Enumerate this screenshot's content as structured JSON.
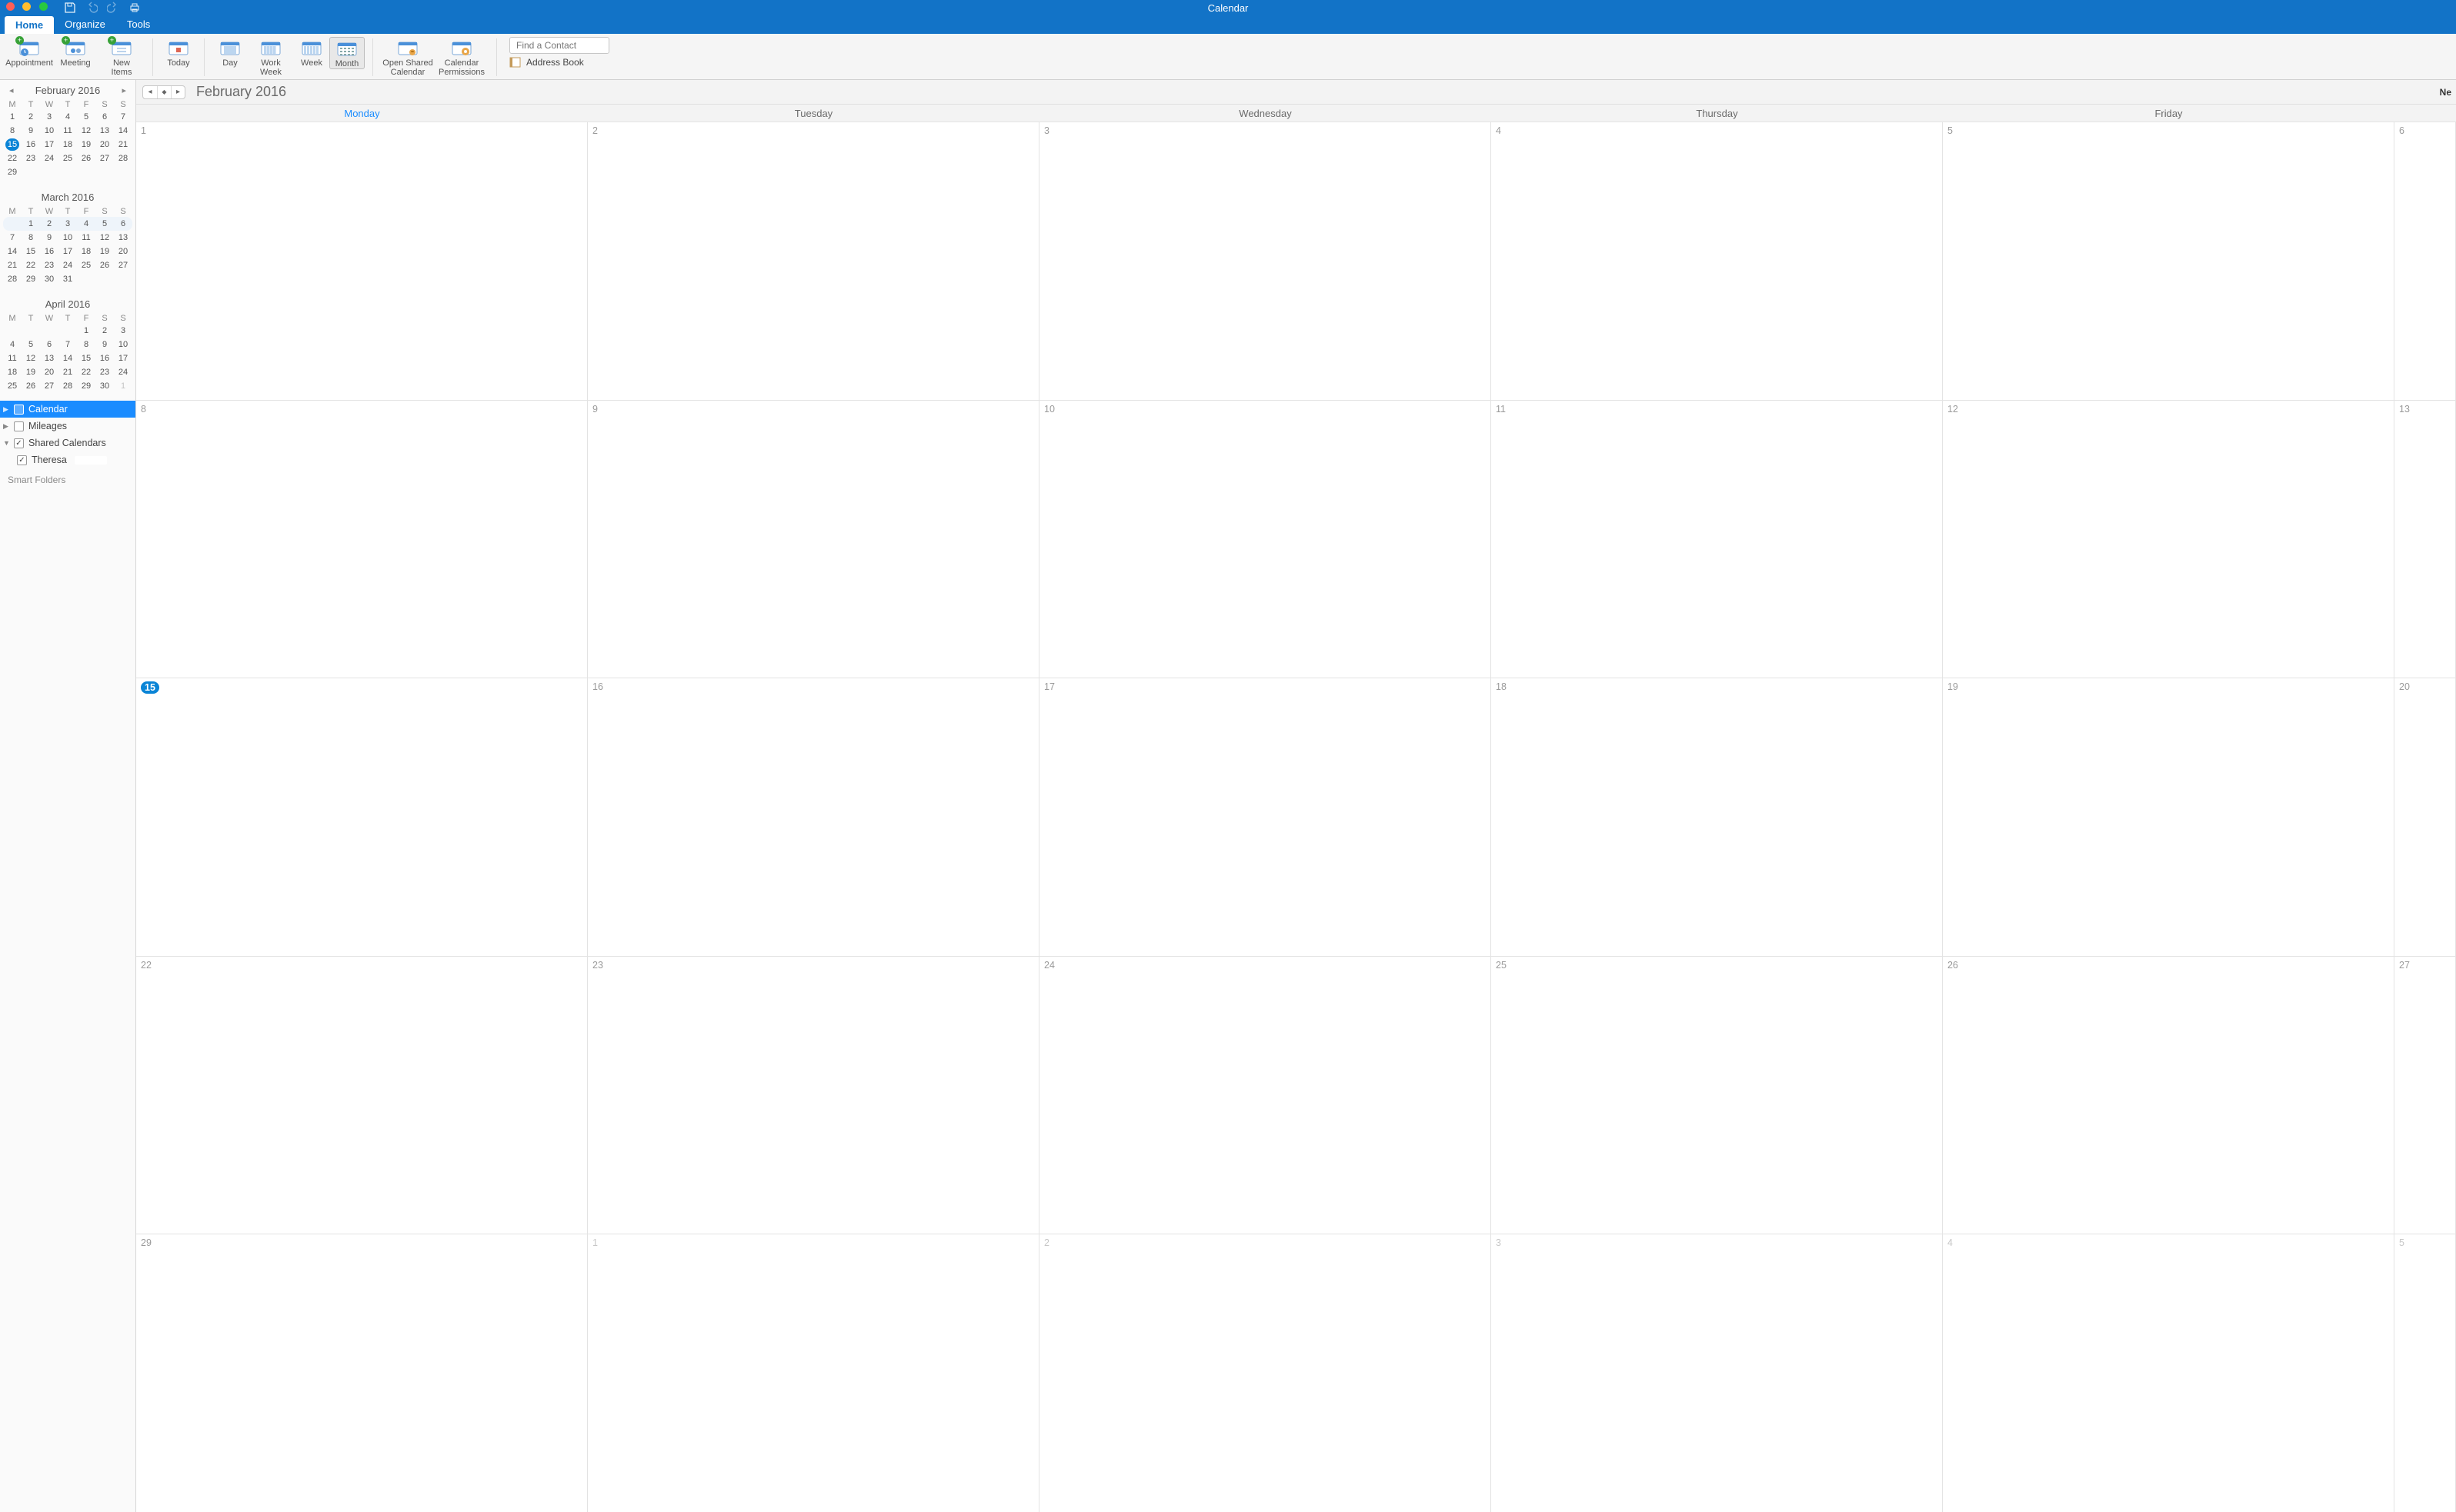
{
  "window": {
    "title": "Calendar",
    "truncated_right": "Ne"
  },
  "menutabs": [
    "Home",
    "Organize",
    "Tools"
  ],
  "active_tab": 0,
  "ribbon": {
    "groups": [
      [
        {
          "id": "appointment",
          "label": "Appointment",
          "plus": true
        },
        {
          "id": "meeting",
          "label": "Meeting",
          "plus": true
        },
        {
          "id": "new-items",
          "label": "New\nItems",
          "plus": true
        }
      ],
      [
        {
          "id": "today",
          "label": "Today"
        }
      ],
      [
        {
          "id": "day",
          "label": "Day"
        },
        {
          "id": "work-week",
          "label": "Work\nWeek"
        },
        {
          "id": "week",
          "label": "Week"
        },
        {
          "id": "month",
          "label": "Month",
          "selected": true
        }
      ],
      [
        {
          "id": "open-shared",
          "label": "Open Shared\nCalendar"
        },
        {
          "id": "perms",
          "label": "Calendar\nPermissions"
        }
      ]
    ],
    "find_placeholder": "Find a Contact",
    "address_book": "Address Book"
  },
  "sidebar": {
    "dow": [
      "M",
      "T",
      "W",
      "T",
      "F",
      "S",
      "S"
    ],
    "months": [
      {
        "title": "February 2016",
        "nav": true,
        "today": [
          3,
          0
        ],
        "rows": [
          [
            "1",
            "2",
            "3",
            "4",
            "5",
            "6",
            "7"
          ],
          [
            "8",
            "9",
            "10",
            "11",
            "12",
            "13",
            "14"
          ],
          [
            "15",
            "16",
            "17",
            "18",
            "19",
            "20",
            "21"
          ],
          [
            "22",
            "23",
            "24",
            "25",
            "26",
            "27",
            "28"
          ],
          [
            "29",
            "",
            "",
            "",
            "",
            "",
            ""
          ]
        ],
        "highlight_rows": []
      },
      {
        "title": "March 2016",
        "nav": false,
        "rows": [
          [
            "",
            "1",
            "2",
            "3",
            "4",
            "5",
            "6"
          ],
          [
            "7",
            "8",
            "9",
            "10",
            "11",
            "12",
            "13"
          ],
          [
            "14",
            "15",
            "16",
            "17",
            "18",
            "19",
            "20"
          ],
          [
            "21",
            "22",
            "23",
            "24",
            "25",
            "26",
            "27"
          ],
          [
            "28",
            "29",
            "30",
            "31",
            "",
            "",
            ""
          ]
        ],
        "highlight_rows": [
          0
        ]
      },
      {
        "title": "April 2016",
        "nav": false,
        "rows": [
          [
            "",
            "",
            "",
            "",
            "1",
            "2",
            "3"
          ],
          [
            "4",
            "5",
            "6",
            "7",
            "8",
            "9",
            "10"
          ],
          [
            "11",
            "12",
            "13",
            "14",
            "15",
            "16",
            "17"
          ],
          [
            "18",
            "19",
            "20",
            "21",
            "22",
            "23",
            "24"
          ],
          [
            "25",
            "26",
            "27",
            "28",
            "29",
            "30",
            "1"
          ]
        ],
        "dim": [
          [
            4,
            6
          ]
        ],
        "highlight_rows": []
      }
    ],
    "lists": {
      "calendar": "Calendar",
      "mileages": "Mileages",
      "shared": "Shared Calendars",
      "theresa": "Theresa",
      "smart": "Smart Folders"
    }
  },
  "calendar": {
    "title": "February 2016",
    "dow": [
      "Monday",
      "Tuesday",
      "Wednesday",
      "Thursday",
      "Friday",
      ""
    ],
    "today_col": 0,
    "weeks": [
      [
        {
          "n": "1"
        },
        {
          "n": "2"
        },
        {
          "n": "3"
        },
        {
          "n": "4"
        },
        {
          "n": "5"
        },
        {
          "n": "6"
        }
      ],
      [
        {
          "n": "8"
        },
        {
          "n": "9"
        },
        {
          "n": "10"
        },
        {
          "n": "11"
        },
        {
          "n": "12"
        },
        {
          "n": "13"
        }
      ],
      [
        {
          "n": "15",
          "today": true
        },
        {
          "n": "16"
        },
        {
          "n": "17"
        },
        {
          "n": "18"
        },
        {
          "n": "19"
        },
        {
          "n": "20"
        }
      ],
      [
        {
          "n": "22"
        },
        {
          "n": "23"
        },
        {
          "n": "24"
        },
        {
          "n": "25"
        },
        {
          "n": "26"
        },
        {
          "n": "27"
        }
      ],
      [
        {
          "n": "29"
        },
        {
          "n": "1",
          "out": true
        },
        {
          "n": "2",
          "out": true
        },
        {
          "n": "3",
          "out": true
        },
        {
          "n": "4",
          "out": true
        },
        {
          "n": "5",
          "out": true
        }
      ]
    ]
  }
}
